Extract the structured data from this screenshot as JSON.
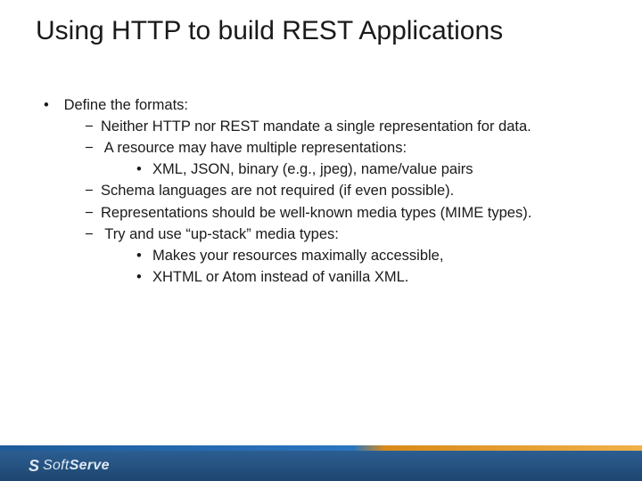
{
  "title": "Using HTTP to build REST Applications",
  "bullets": {
    "l1": "Define the formats:",
    "l2a": "Neither HTTP nor REST mandate a single representation for data.",
    "l2b": "A resource may have multiple representations:",
    "l3a": "XML, JSON, binary (e.g., jpeg), name/value pairs",
    "l2c": "Schema languages are not required (if even possible).",
    "l2d": "Representations should be well-known media types (MIME types).",
    "l2e": "Try and use “up-stack” media types:",
    "l3b": "Makes your resources maximally accessible,",
    "l3c": "XHTML or Atom instead of vanilla XML."
  },
  "footer": {
    "brand_soft": "Soft",
    "brand_serve": "Serve"
  }
}
